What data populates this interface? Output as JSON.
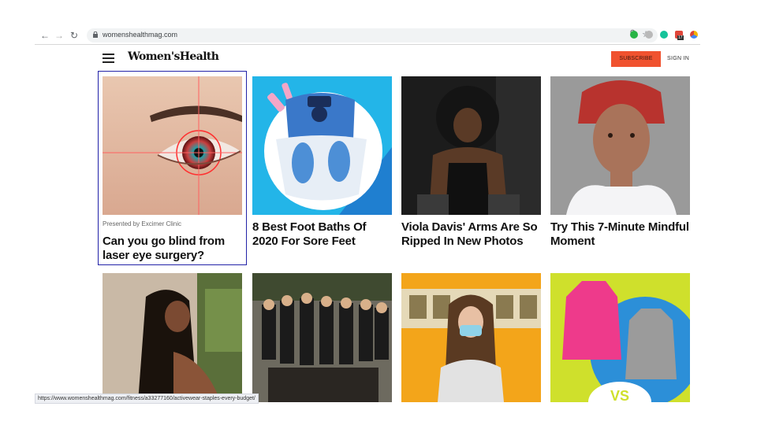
{
  "browser": {
    "url": "womenshealthmag.com",
    "status_url": "https://www.womenshealthmag.com/fitness/a33277160/activewear-staples-every-budget/",
    "extension_badge": "17"
  },
  "site": {
    "logo": "Women'sHealth",
    "subscribe_label": "SUBSCRIBE",
    "signin_label": "SIGN IN",
    "accent_color": "#f0522f"
  },
  "cards": [
    {
      "presented": "Presented by Excimer Clinic",
      "title": "Can you go blind from laser eye surgery?"
    },
    {
      "title": "8 Best Foot Baths Of 2020 For Sore Feet"
    },
    {
      "title": "Viola Davis' Arms Are So Ripped In New Photos"
    },
    {
      "title": "Try This 7-Minute Mindful Moment"
    }
  ],
  "second_row_badge": "VS"
}
